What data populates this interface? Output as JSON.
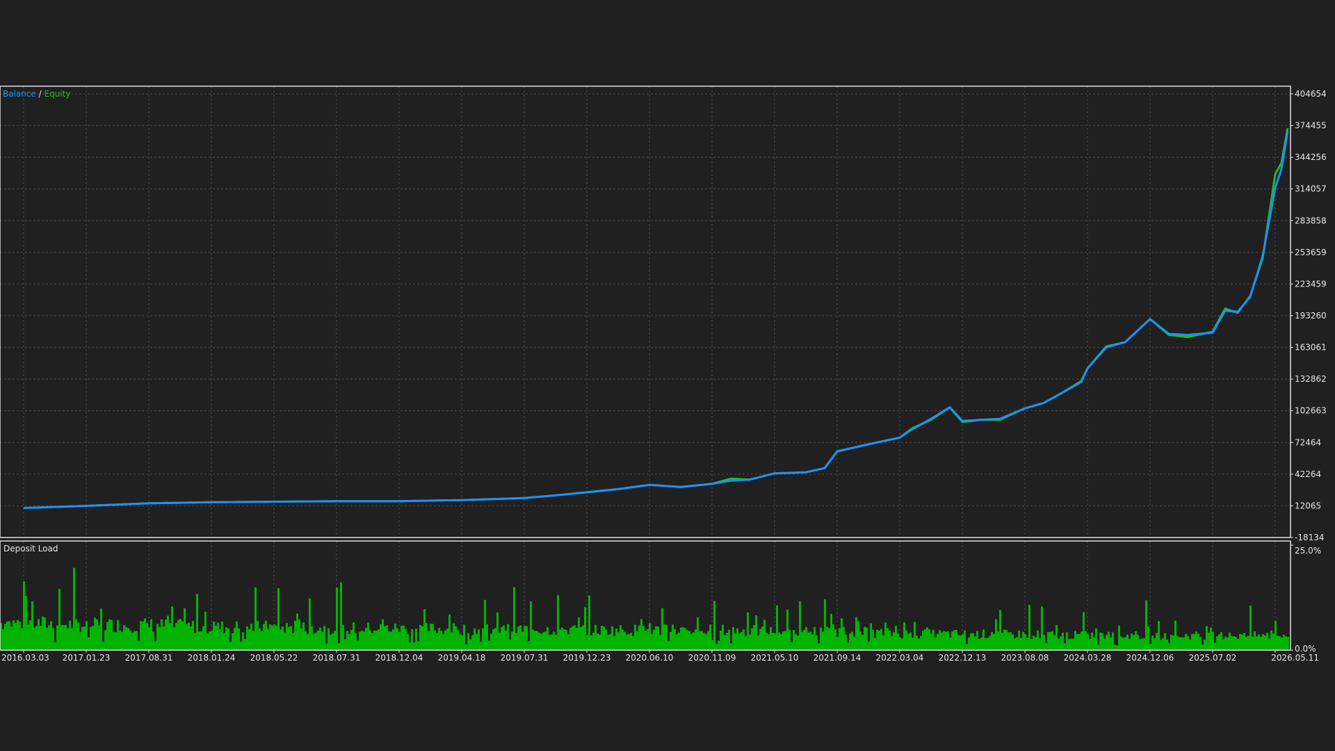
{
  "colors": {
    "background": "#202020",
    "frame": "#e0e0e0",
    "grid": "#4a4a4a",
    "balance": "#1e90ff",
    "equity": "#22bb22",
    "deposit_load": "#00b400",
    "text": "#e6e6e6"
  },
  "chart_data": [
    {
      "type": "line",
      "legend": {
        "balance_label": "Balance",
        "separator": " / ",
        "equity_label": "Equity",
        "position": "top-left"
      },
      "grid": true,
      "ylim": [
        -18134,
        404654
      ],
      "y_ticks": [
        "404654",
        "374455",
        "344256",
        "314057",
        "283858",
        "253659",
        "223459",
        "193260",
        "163061",
        "132862",
        "102663",
        "72464",
        "42264",
        "12065",
        "-18134"
      ],
      "y_tick_values": [
        404654,
        374455,
        344256,
        314057,
        283858,
        253659,
        223459,
        193260,
        163061,
        132862,
        102663,
        72464,
        42264,
        12065,
        -18134
      ],
      "x_ticks": [
        "2016.03.03",
        "2017.01.23",
        "2017.08.31",
        "2018.01.24",
        "2018.05.22",
        "2018.07.31",
        "2018.12.04",
        "2019.04.18",
        "2019.07.31",
        "2019.12.23",
        "2020.06.10",
        "2020.11.09",
        "2021.05.10",
        "2021.09.14",
        "2022.03.04",
        "2022.12.13",
        "2023.08.08",
        "2024.03.28",
        "2024.12.06",
        "2025.07.02",
        "2026.05.11"
      ],
      "series": [
        {
          "name": "Balance",
          "x": [
            0,
            1,
            2,
            3,
            4,
            5,
            6,
            7,
            7.5,
            8,
            8.5,
            9,
            9.5,
            10,
            10.5,
            11,
            11.3,
            11.6,
            12,
            12.5,
            12.8,
            13,
            13.3,
            13.6,
            14,
            14.2,
            14.5,
            14.8,
            15,
            15.3,
            15.6,
            16,
            16.3,
            16.6,
            16.9,
            17,
            17.3,
            17.6,
            18,
            18.3,
            18.6,
            19,
            19.2,
            19.4,
            19.6,
            19.8,
            20,
            20.1,
            20.2
          ],
          "values": [
            10000,
            12000,
            14500,
            15500,
            16000,
            16500,
            16500,
            17500,
            18500,
            19500,
            22000,
            25000,
            28000,
            32000,
            30000,
            33000,
            36000,
            37000,
            43000,
            44000,
            48000,
            64000,
            68000,
            72000,
            77000,
            85000,
            95000,
            106000,
            93000,
            94000,
            95000,
            105000,
            110000,
            120000,
            130000,
            143000,
            163000,
            168000,
            190000,
            176000,
            175000,
            177000,
            198000,
            197000,
            211000,
            250000,
            315000,
            333000,
            369000
          ]
        },
        {
          "name": "Equity",
          "x": [
            0,
            1,
            2,
            3,
            4,
            5,
            6,
            7,
            7.5,
            8,
            8.5,
            9,
            9.5,
            10,
            10.5,
            11,
            11.3,
            11.6,
            12,
            12.5,
            12.8,
            13,
            13.3,
            13.6,
            14,
            14.2,
            14.5,
            14.8,
            15,
            15.3,
            15.6,
            16,
            16.3,
            16.6,
            16.9,
            17,
            17.3,
            17.6,
            18,
            18.3,
            18.6,
            19,
            19.2,
            19.4,
            19.6,
            19.8,
            20,
            20.1,
            20.2
          ],
          "values": [
            10000,
            12000,
            14500,
            15500,
            16000,
            16500,
            16500,
            17500,
            18500,
            19500,
            22000,
            25000,
            28000,
            32000,
            30000,
            33000,
            38000,
            37000,
            43000,
            44000,
            48000,
            64000,
            68000,
            72000,
            77000,
            86000,
            94000,
            106000,
            92000,
            94000,
            94000,
            105000,
            110000,
            120000,
            131000,
            143000,
            164000,
            168000,
            190000,
            175000,
            173000,
            178000,
            200000,
            196000,
            212000,
            248000,
            328000,
            339000,
            372000
          ]
        }
      ]
    },
    {
      "type": "bar",
      "title": "Deposit Load",
      "ylim": [
        0,
        25
      ],
      "y_ticks": [
        "25.0%",
        "0.0%"
      ],
      "y_tick_values": [
        25,
        0
      ],
      "x_ticks": [
        "2016.03.03",
        "2017.01.23",
        "2017.08.31",
        "2018.01.24",
        "2018.05.22",
        "2018.07.31",
        "2018.12.04",
        "2019.04.18",
        "2019.07.31",
        "2019.12.23",
        "2020.06.10",
        "2020.11.09",
        "2021.05.10",
        "2021.09.14",
        "2022.03.04",
        "2022.12.13",
        "2023.08.08",
        "2024.03.28",
        "2024.12.06",
        "2025.07.02",
        "2026.05.11"
      ],
      "series": [
        {
          "name": "Deposit Load",
          "x": [
            0,
            1,
            2,
            3,
            4,
            5,
            6,
            7,
            8,
            9,
            10,
            11,
            12,
            13,
            14,
            15,
            16,
            17,
            18,
            19,
            20,
            20.2
          ],
          "values": [
            6.5,
            6,
            6,
            5.5,
            5.5,
            5.2,
            5.2,
            5,
            5,
            4.8,
            4.8,
            4.8,
            4.5,
            4.5,
            4,
            3.8,
            3.8,
            3.5,
            3.5,
            3.5,
            3.5,
            3.5
          ]
        }
      ]
    }
  ]
}
